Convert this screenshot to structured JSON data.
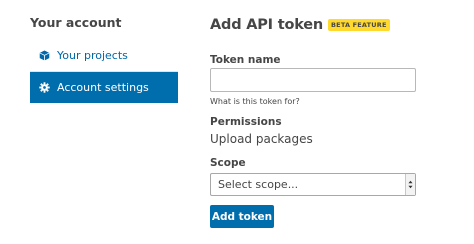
{
  "sidebar": {
    "heading": "Your account",
    "items": [
      {
        "label": "Your projects",
        "icon": "box-icon",
        "active": false
      },
      {
        "label": "Account settings",
        "icon": "gear-icon",
        "active": true
      }
    ]
  },
  "main": {
    "title": "Add API token",
    "badge": "BETA FEATURE",
    "token_name": {
      "label": "Token name",
      "value": "",
      "help": "What is this token for?"
    },
    "permissions": {
      "label": "Permissions",
      "value": "Upload packages"
    },
    "scope": {
      "label": "Scope",
      "selected": "Select scope..."
    },
    "submit_label": "Add token"
  },
  "colors": {
    "accent": "#006dad",
    "link": "#0067a8",
    "badge": "#ffd92c",
    "text": "#464646"
  }
}
